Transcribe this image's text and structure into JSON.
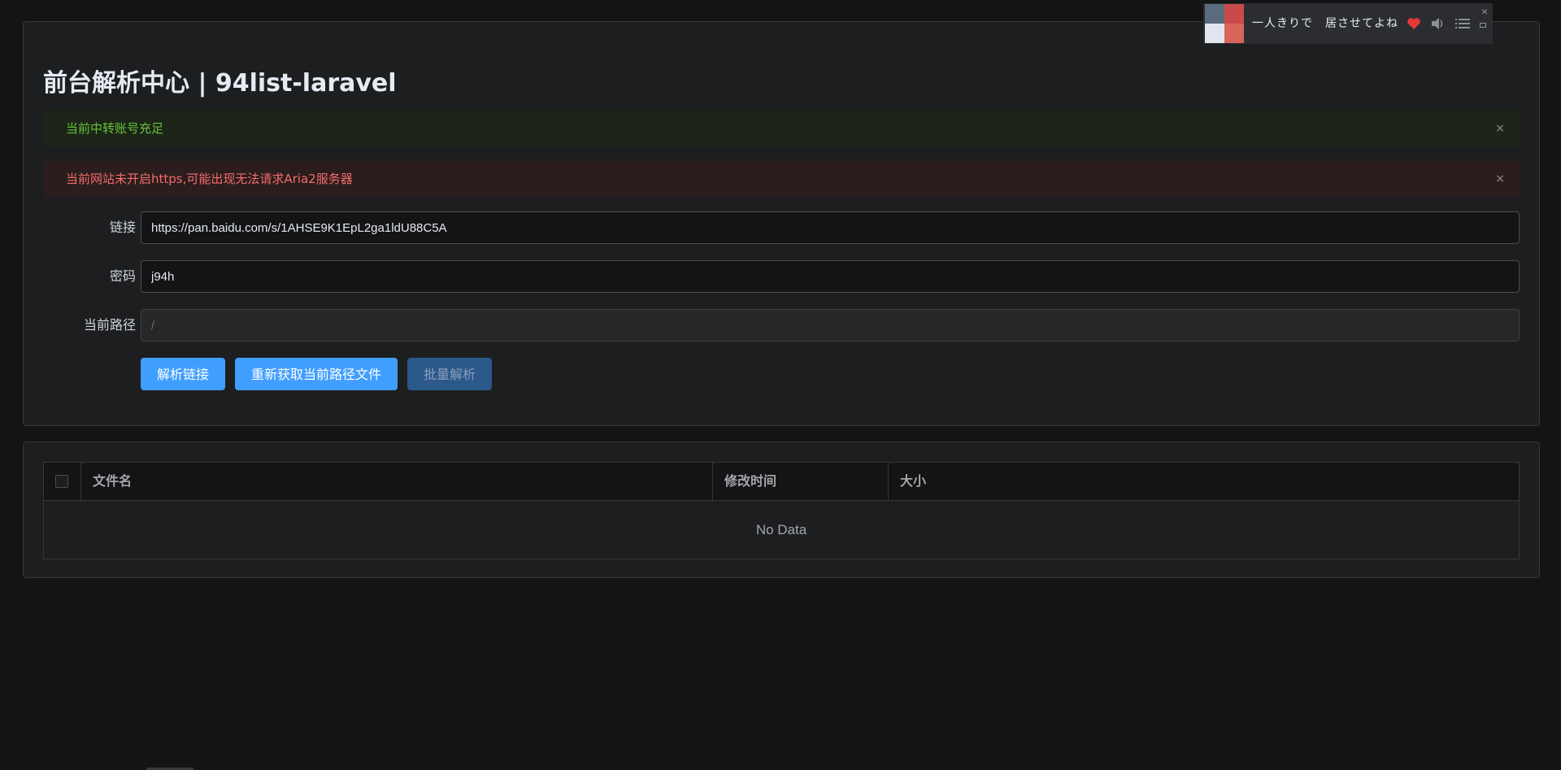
{
  "page": {
    "title": "前台解析中心 | 94list-laravel"
  },
  "alerts": {
    "success": {
      "text": "当前中转账号充足",
      "close": "×"
    },
    "error": {
      "text": "当前网站未开启https,可能出现无法请求Aria2服务器",
      "close": "×"
    }
  },
  "form": {
    "link": {
      "label": "链接",
      "value": "https://pan.baidu.com/s/1AHSE9K1EpL2ga1ldU88C5A"
    },
    "password": {
      "label": "密码",
      "value": "j94h"
    },
    "path": {
      "label": "当前路径",
      "value": "/"
    }
  },
  "buttons": {
    "parse": "解析链接",
    "refresh": "重新获取当前路径文件",
    "batch": "批量解析"
  },
  "table": {
    "columns": [
      "文件名",
      "修改时间",
      "大小"
    ],
    "empty_text": "No Data"
  },
  "player": {
    "title": "一人きりで　居させてよね",
    "close": "×"
  },
  "colors": {
    "primary": "#409eff",
    "success": "#67c23a",
    "danger": "#f56c6c",
    "heart": "#e53935"
  },
  "icons": [
    "close-icon",
    "checkbox",
    "heart-icon",
    "volume-icon",
    "playlist-icon",
    "minimize-icon"
  ]
}
